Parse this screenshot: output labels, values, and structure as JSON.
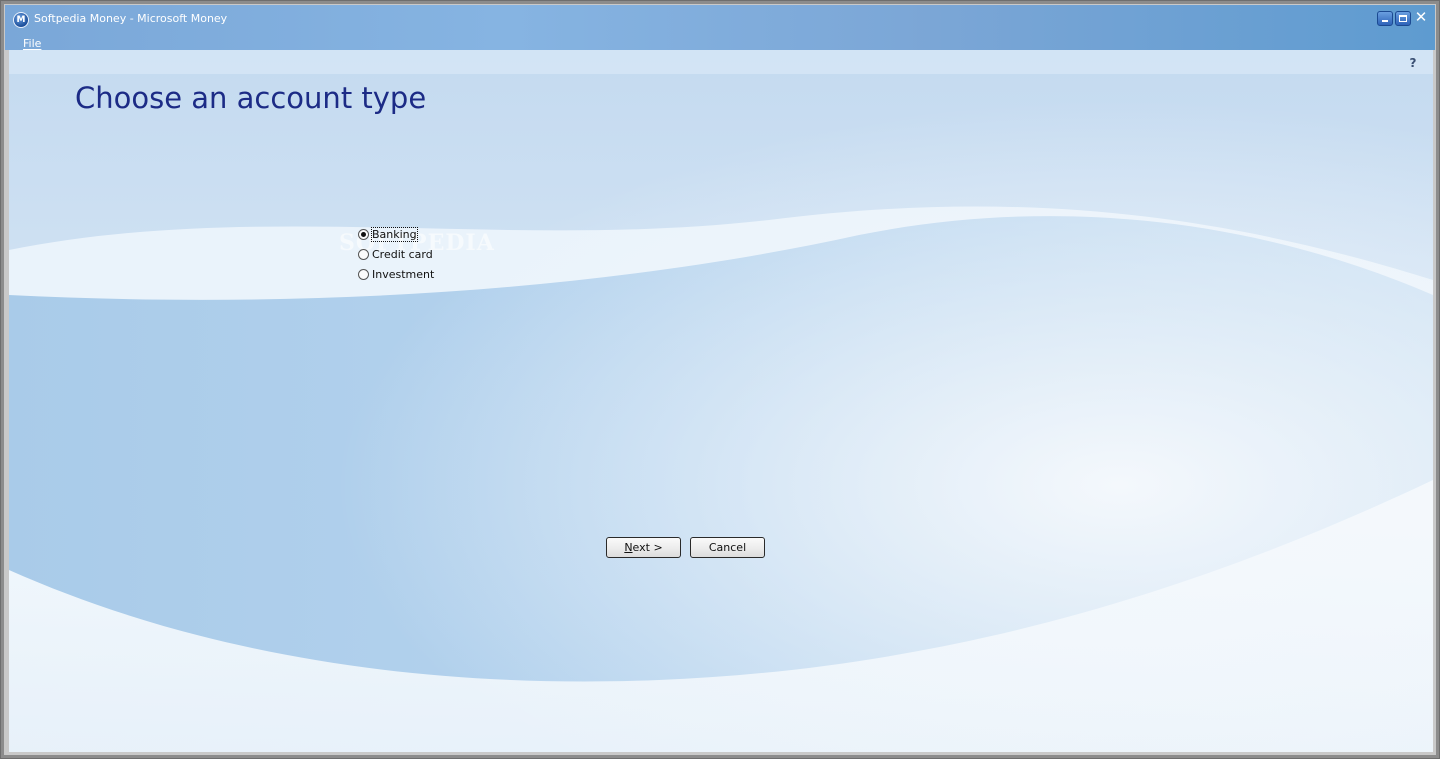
{
  "window": {
    "title": "Softpedia Money - Microsoft Money",
    "app_icon_letter": "M"
  },
  "menu": {
    "items": [
      {
        "label": "File",
        "mnemonic": "F"
      }
    ]
  },
  "page": {
    "title": "Choose an account type",
    "help_label": "?"
  },
  "account_types": {
    "options": [
      {
        "label": "Banking",
        "selected": true
      },
      {
        "label": "Credit card",
        "selected": false
      },
      {
        "label": "Investment",
        "selected": false
      }
    ]
  },
  "buttons": {
    "next": {
      "mnemonic": "N",
      "rest": "ext >"
    },
    "cancel": "Cancel"
  },
  "watermark": "SOFTPEDIA",
  "colors": {
    "title_text": "#1c2b86",
    "titlebar": "#7aa7d8",
    "background": "#d6e6f5"
  }
}
